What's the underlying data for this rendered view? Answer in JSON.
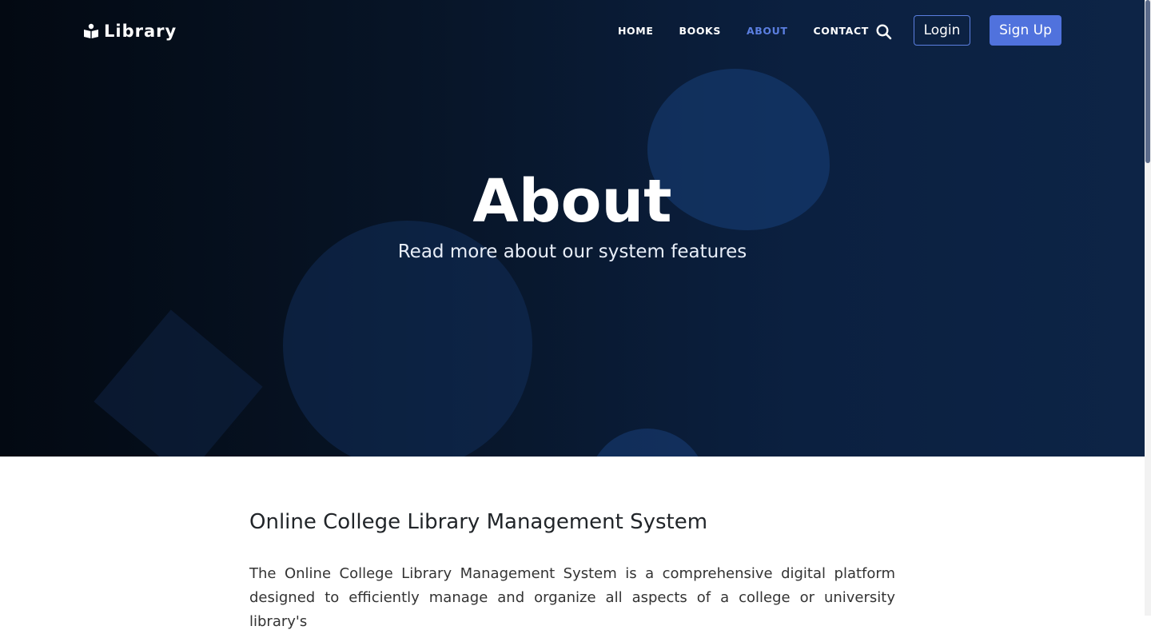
{
  "nav": {
    "brand": "Library",
    "links": [
      {
        "label": "HOME",
        "active": false
      },
      {
        "label": "BOOKS",
        "active": false
      },
      {
        "label": "ABOUT",
        "active": true
      },
      {
        "label": "CONTACT",
        "active": false
      }
    ],
    "login_label": "Login",
    "signup_label": "Sign Up"
  },
  "hero": {
    "title": "About",
    "subtitle": "Read more about our system features"
  },
  "content": {
    "heading": "Online College Library Management System",
    "paragraph": "The Online College Library Management System is a comprehensive digital platform designed to efficiently manage and organize all aspects of a college or university library's"
  },
  "colors": {
    "accent": "#5072dd",
    "active_link": "#5b7fe0",
    "hero_dark": "#030912",
    "hero_light": "#0d2446"
  }
}
